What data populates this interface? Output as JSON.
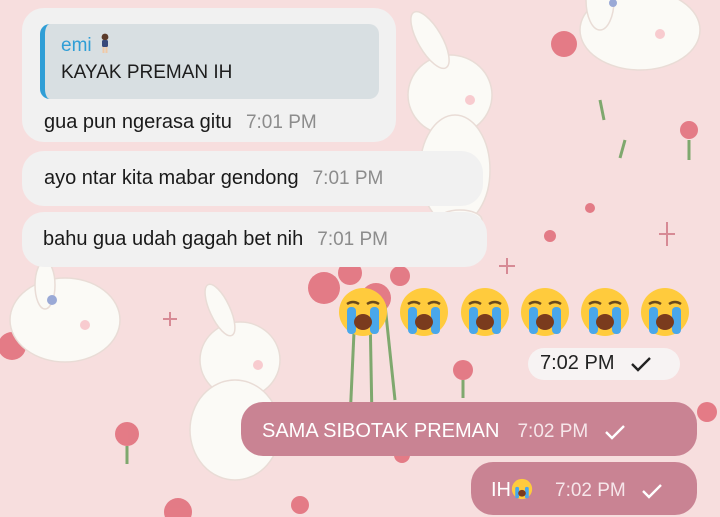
{
  "chat": {
    "quote": {
      "name": "emi",
      "text": "KAYAK PREMAN IH"
    },
    "incoming": [
      {
        "text": "gua pun ngerasa gitu",
        "time": "7:01 PM"
      },
      {
        "text": "ayo ntar kita mabar gendong",
        "time": "7:01 PM"
      },
      {
        "text": "bahu gua udah gagah bet nih",
        "time": "7:01 PM"
      }
    ],
    "emoji_message": {
      "count": 6,
      "emoji_name": "loudly-crying-face",
      "time": "7:02 PM"
    },
    "outgoing": [
      {
        "text": "SAMA SIBOTAK PREMAN",
        "time": "7:02 PM"
      },
      {
        "text": "IH",
        "time": "7:02 PM"
      }
    ]
  },
  "colors": {
    "wallpaper": "#f7dede",
    "incoming_bubble": "#f1f1f1",
    "outgoing_bubble": "#c98393",
    "quote_accent": "#2f9ed6"
  }
}
